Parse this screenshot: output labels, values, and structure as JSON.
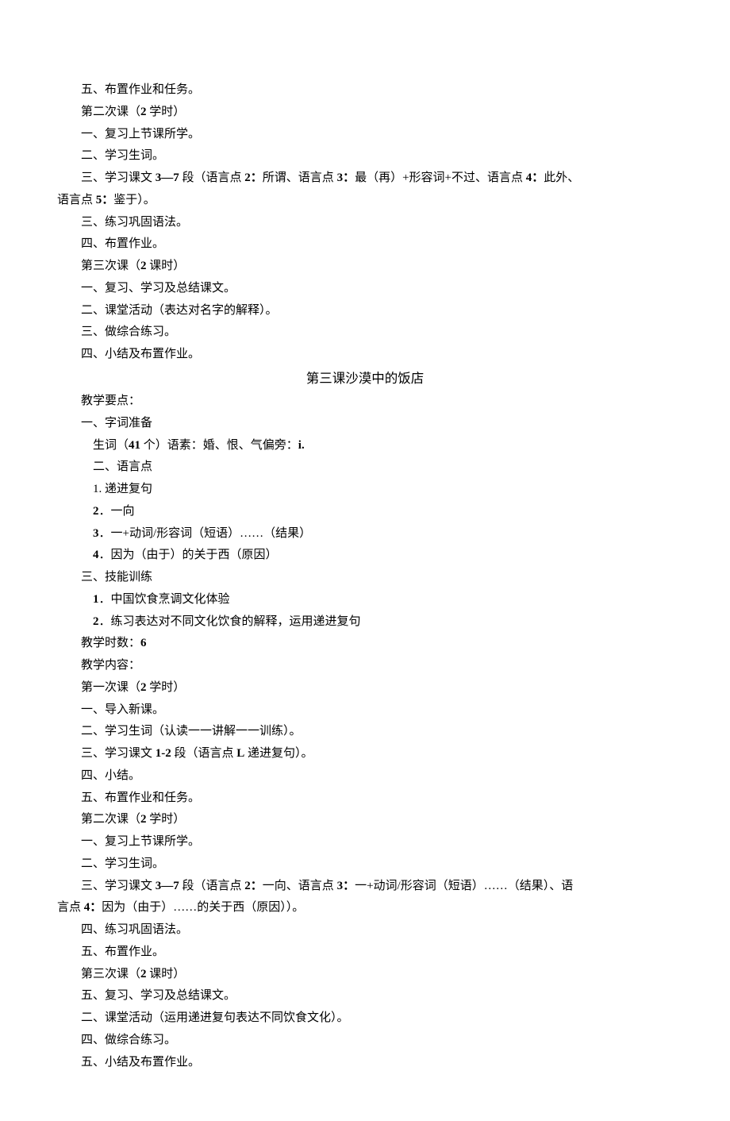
{
  "lines": {
    "l1": "五、布置作业和任务。",
    "l2_a": "第二次课（",
    "l2_b": "2",
    "l2_c": " 学时）",
    "l3": "一、复习上节课所学。",
    "l4": "二、学习生词。",
    "l5_a": "三、学习课文 ",
    "l5_b": "3—7",
    "l5_c": " 段（语言点 ",
    "l5_d": "2：",
    "l5_e": "所谓、语言点 ",
    "l5_f": "3：",
    "l5_g": "最（再）+形容词+不过、语言点 ",
    "l5_h": "4：",
    "l5_i": "此外、",
    "l6_a": "语言点 ",
    "l6_b": "5：",
    "l6_c": "鉴于）。",
    "l7": "三、练习巩固语法。",
    "l8": "四、布置作业。",
    "l9_a": "第三次课（",
    "l9_b": "2",
    "l9_c": " 课时）",
    "l10": "一、复习、学习及总结课文。",
    "l11": "二、课堂活动（表达对名字的解释）。",
    "l12": "三、做综合练习。",
    "l13": "四、小结及布置作业。",
    "h1": "第三课沙漠中的饭店",
    "l14": "教学要点：",
    "l15": "一、字词准备",
    "l16_a": "生词（",
    "l16_b": "41",
    "l16_c": " 个）语素：婚、恨、气偏旁：",
    "l16_d": "i.",
    "l17": "二、语言点",
    "l18": "1. 递进复句",
    "l19_a": "2",
    "l19_b": "．一向",
    "l20_a": "3",
    "l20_b": "．一+动词/形容词（短语）……（结果）",
    "l21_a": "4",
    "l21_b": "．因为（由于）的关于西（原因）",
    "l22": "三、技能训练",
    "l23_a": "1",
    "l23_b": "．中国饮食烹调文化体验",
    "l24_a": "2",
    "l24_b": "．练习表达对不同文化饮食的解释，运用递进复句",
    "l25_a": "教学时数：",
    "l25_b": "6",
    "l26": "教学内容：",
    "l27_a": "第一次课（",
    "l27_b": "2",
    "l27_c": " 学时）",
    "l28": "一、导入新课。",
    "l29": "二、学习生词（认读一一讲解一一训练）。",
    "l30_a": "三、学习课文 ",
    "l30_b": "1-2",
    "l30_c": " 段（语言点 ",
    "l30_d": "L",
    "l30_e": " 递进复句）。",
    "l31": "四、小结。",
    "l32": "五、布置作业和任务。",
    "l33_a": "第二次课（",
    "l33_b": "2",
    "l33_c": " 学时）",
    "l34": "一、复习上节课所学。",
    "l35": "二、学习生词。",
    "l36_a": "三、学习课文 ",
    "l36_b": "3—7",
    "l36_c": " 段（语言点 ",
    "l36_d": "2：",
    "l36_e": "一向、语言点 ",
    "l36_f": "3：",
    "l36_g": "一+动词/形容词（短语）……（结果）、语",
    "l37_a": "言点 ",
    "l37_b": "4：",
    "l37_c": "因为（由于）……的关于西（原因））。",
    "l38": "四、练习巩固语法。",
    "l39": "五、布置作业。",
    "l40_a": "第三次课（",
    "l40_b": "2",
    "l40_c": " 课时）",
    "l41": "五、复习、学习及总结课文。",
    "l42": "二、课堂活动（运用递进复句表达不同饮食文化）。",
    "l43": "四、做综合练习。",
    "l44": "五、小结及布置作业。"
  }
}
